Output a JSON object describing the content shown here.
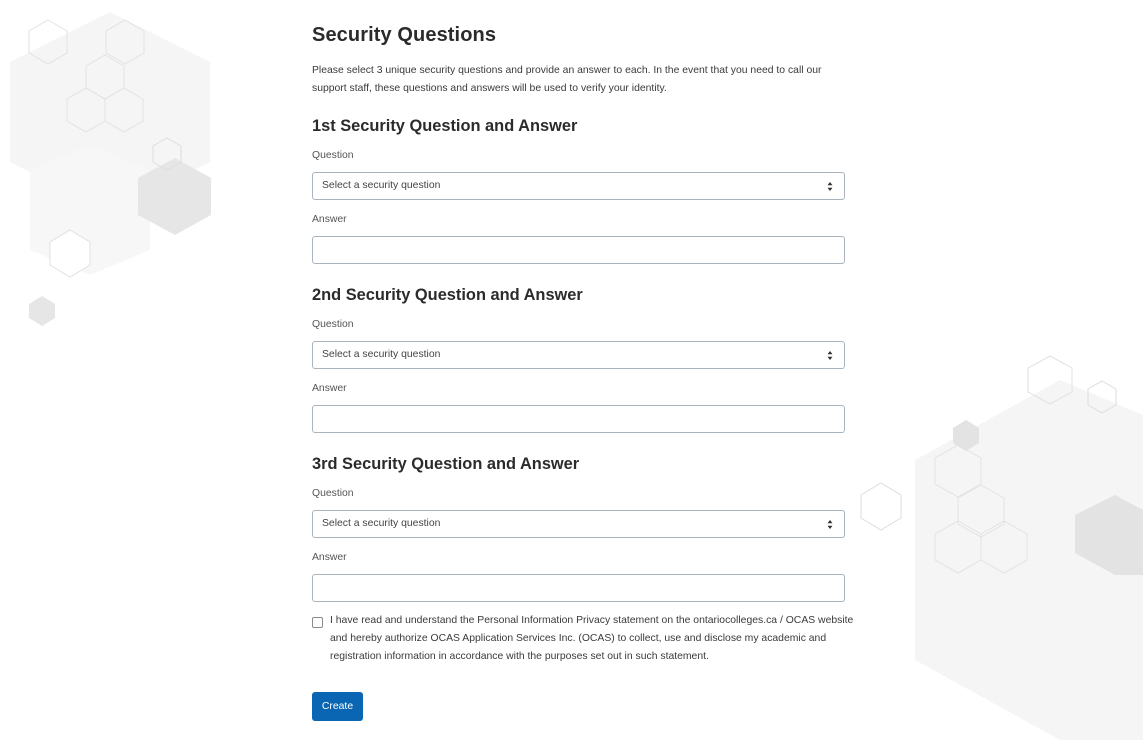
{
  "page": {
    "title": "Security Questions",
    "intro": "Please select 3 unique security questions and provide an answer to each. In the event that you need to call our support staff, these questions and answers will be used to verify your identity."
  },
  "sections": [
    {
      "heading": "1st Security Question and Answer",
      "question_label": "Question",
      "question_value": "Select a security question",
      "answer_label": "Answer",
      "answer_value": ""
    },
    {
      "heading": "2nd Security Question and Answer",
      "question_label": "Question",
      "question_value": "Select a security question",
      "answer_label": "Answer",
      "answer_value": ""
    },
    {
      "heading": "3rd Security Question and Answer",
      "question_label": "Question",
      "question_value": "Select a security question",
      "answer_label": "Answer",
      "answer_value": ""
    }
  ],
  "consent": {
    "checked": false,
    "text": "I have read and understand the Personal Information Privacy statement on the ontariocolleges.ca / OCAS website and hereby authorize OCAS Application Services Inc. (OCAS) to collect, use and disclose my academic and registration information in accordance with the purposes set out in such statement."
  },
  "actions": {
    "create_label": "Create"
  },
  "colors": {
    "primary": "#0a66b2",
    "input_border": "#a9b4bf",
    "text": "#2b2b2b"
  },
  "icons": {
    "select_caret": "sort-caret-icon"
  }
}
